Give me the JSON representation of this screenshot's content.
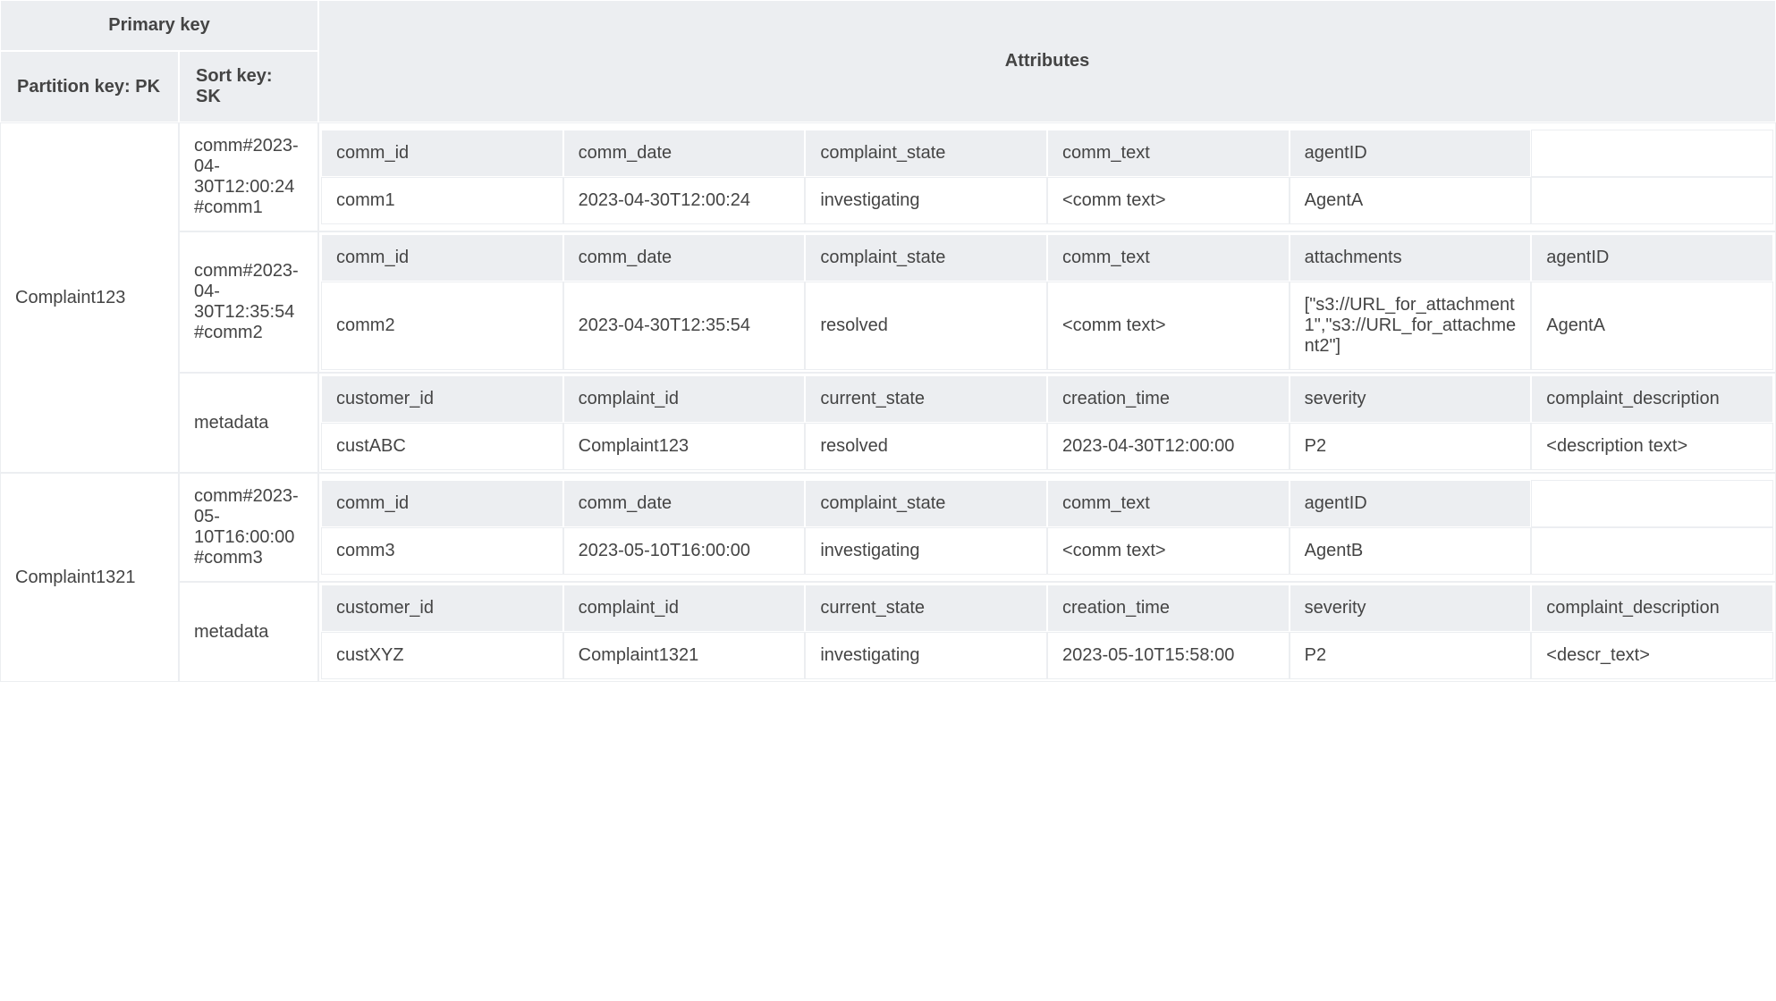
{
  "headers": {
    "primary_key": "Primary key",
    "partition_key": "Partition key: PK",
    "sort_key": "Sort key: SK",
    "attributes": "Attributes"
  },
  "rows": [
    {
      "pk": "Complaint123",
      "items": [
        {
          "sk": "comm#2023-04-30T12:00:24#comm1",
          "attrs": [
            {
              "k": "comm_id",
              "v": "comm1"
            },
            {
              "k": "comm_date",
              "v": "2023-04-30T12:00:24"
            },
            {
              "k": "complaint_state",
              "v": "investigating"
            },
            {
              "k": "comm_text",
              "v": "<comm text>"
            },
            {
              "k": "agentID",
              "v": "AgentA"
            },
            {
              "k": "",
              "v": ""
            }
          ]
        },
        {
          "sk": "comm#2023-04-30T12:35:54#comm2",
          "attrs": [
            {
              "k": "comm_id",
              "v": "comm2"
            },
            {
              "k": "comm_date",
              "v": "2023-04-30T12:35:54"
            },
            {
              "k": "complaint_state",
              "v": "resolved"
            },
            {
              "k": "comm_text",
              "v": "<comm text>"
            },
            {
              "k": "attachments",
              "v": "[\"s3://URL_for_attachment1\",\"s3://URL_for_attachment2\"]"
            },
            {
              "k": "agentID",
              "v": "AgentA"
            }
          ]
        },
        {
          "sk": "metadata",
          "attrs": [
            {
              "k": "customer_id",
              "v": "custABC"
            },
            {
              "k": "complaint_id",
              "v": "Complaint123"
            },
            {
              "k": "current_state",
              "v": "resolved"
            },
            {
              "k": "creation_time",
              "v": "2023-04-30T12:00:00"
            },
            {
              "k": "severity",
              "v": "P2"
            },
            {
              "k": "complaint_description",
              "v": "<description text>"
            }
          ]
        }
      ]
    },
    {
      "pk": "Complaint1321",
      "items": [
        {
          "sk": "comm#2023-05-10T16:00:00#comm3",
          "attrs": [
            {
              "k": "comm_id",
              "v": "comm3"
            },
            {
              "k": "comm_date",
              "v": "2023-05-10T16:00:00"
            },
            {
              "k": "complaint_state",
              "v": "investigating"
            },
            {
              "k": "comm_text",
              "v": "<comm text>"
            },
            {
              "k": "agentID",
              "v": "AgentB"
            },
            {
              "k": "",
              "v": ""
            }
          ]
        },
        {
          "sk": "metadata",
          "attrs": [
            {
              "k": "customer_id",
              "v": "custXYZ"
            },
            {
              "k": "complaint_id",
              "v": "Complaint1321"
            },
            {
              "k": "current_state",
              "v": "investigating"
            },
            {
              "k": "creation_time",
              "v": "2023-05-10T15:58:00"
            },
            {
              "k": "severity",
              "v": "P2"
            },
            {
              "k": "complaint_description",
              "v": "<descr_text>"
            }
          ]
        }
      ]
    }
  ]
}
